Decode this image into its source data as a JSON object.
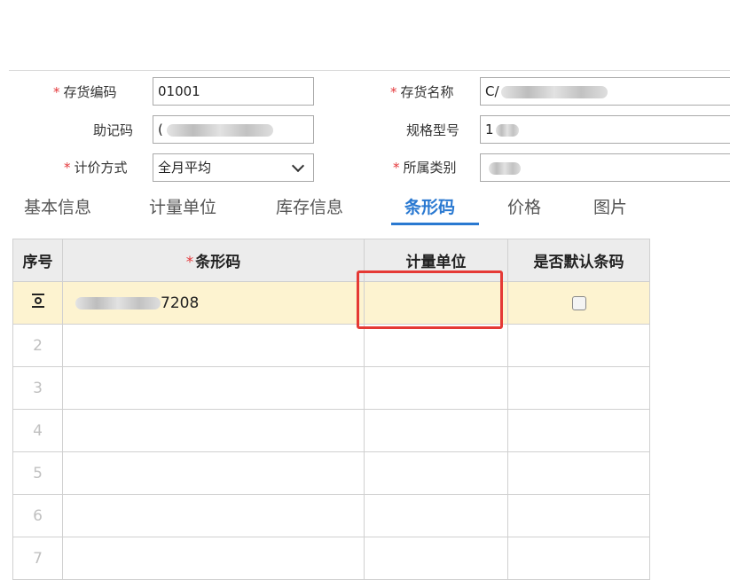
{
  "form": {
    "code_label": "存货编码",
    "code_value": "01001",
    "name_label": "存货名称",
    "name_value": "C/",
    "mnemonic_label": "助记码",
    "mnemonic_value": "(",
    "spec_label": "规格型号",
    "spec_value": "1",
    "pricing_label": "计价方式",
    "pricing_value": "全月平均",
    "category_label": "所属类别",
    "category_value": "",
    "required_mark": "*"
  },
  "tabs": [
    "基本信息",
    "计量单位",
    "库存信息",
    "条形码",
    "价格",
    "图片"
  ],
  "active_tab": "条形码",
  "table": {
    "headers": [
      "序号",
      "条形码",
      "计量单位",
      "是否默认条码"
    ],
    "rows": [
      {
        "no": "",
        "barcode": "7208",
        "unit": "",
        "default": false
      },
      {
        "no": "2",
        "barcode": "",
        "unit": ""
      },
      {
        "no": "3",
        "barcode": "",
        "unit": ""
      },
      {
        "no": "4",
        "barcode": "",
        "unit": ""
      },
      {
        "no": "5",
        "barcode": "",
        "unit": ""
      },
      {
        "no": "6",
        "barcode": "",
        "unit": ""
      },
      {
        "no": "7",
        "barcode": "",
        "unit": ""
      }
    ]
  },
  "colors": {
    "accent": "#2a79d1",
    "required": "#e4393c",
    "selected_row": "#fdf3d0",
    "highlight_box": "#e53935"
  }
}
